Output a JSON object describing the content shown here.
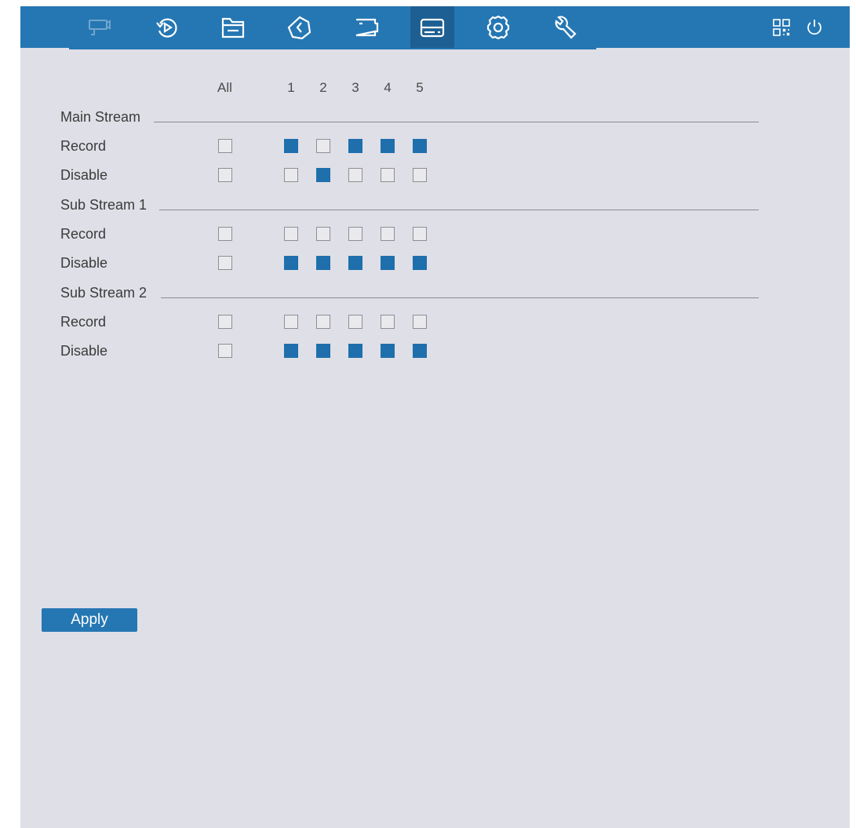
{
  "topbar": {
    "nav": [
      {
        "icon": "camera-icon",
        "state": "disabled"
      },
      {
        "icon": "playback-icon",
        "state": "normal"
      },
      {
        "icon": "file-search-icon",
        "state": "normal"
      },
      {
        "icon": "schedule-clock-icon",
        "state": "normal"
      },
      {
        "icon": "channel-screen-icon",
        "state": "normal"
      },
      {
        "icon": "storage-hdd-icon",
        "state": "active"
      },
      {
        "icon": "settings-gear-icon",
        "state": "normal"
      },
      {
        "icon": "maintenance-wrench-icon",
        "state": "normal"
      }
    ],
    "right": [
      "qr-code-icon",
      "power-icon"
    ],
    "colors": {
      "bar": "#2577b3",
      "active": "#1d5f92"
    }
  },
  "columns": {
    "all_label": "All",
    "channels": [
      "1",
      "2",
      "3",
      "4",
      "5"
    ]
  },
  "sections": [
    {
      "title": "Main Stream",
      "rows": [
        {
          "label": "Record",
          "all": false,
          "channels": [
            true,
            false,
            true,
            true,
            true
          ]
        },
        {
          "label": "Disable",
          "all": false,
          "channels": [
            false,
            true,
            false,
            false,
            false
          ]
        }
      ]
    },
    {
      "title": "Sub Stream 1",
      "rows": [
        {
          "label": "Record",
          "all": false,
          "channels": [
            false,
            false,
            false,
            false,
            false
          ]
        },
        {
          "label": "Disable",
          "all": false,
          "channels": [
            true,
            true,
            true,
            true,
            true
          ]
        }
      ]
    },
    {
      "title": "Sub Stream 2",
      "rows": [
        {
          "label": "Record",
          "all": false,
          "channels": [
            false,
            false,
            false,
            false,
            false
          ]
        },
        {
          "label": "Disable",
          "all": false,
          "channels": [
            true,
            true,
            true,
            true,
            true
          ]
        }
      ]
    }
  ],
  "apply_label": "Apply",
  "accent_color": "#1e6fac"
}
